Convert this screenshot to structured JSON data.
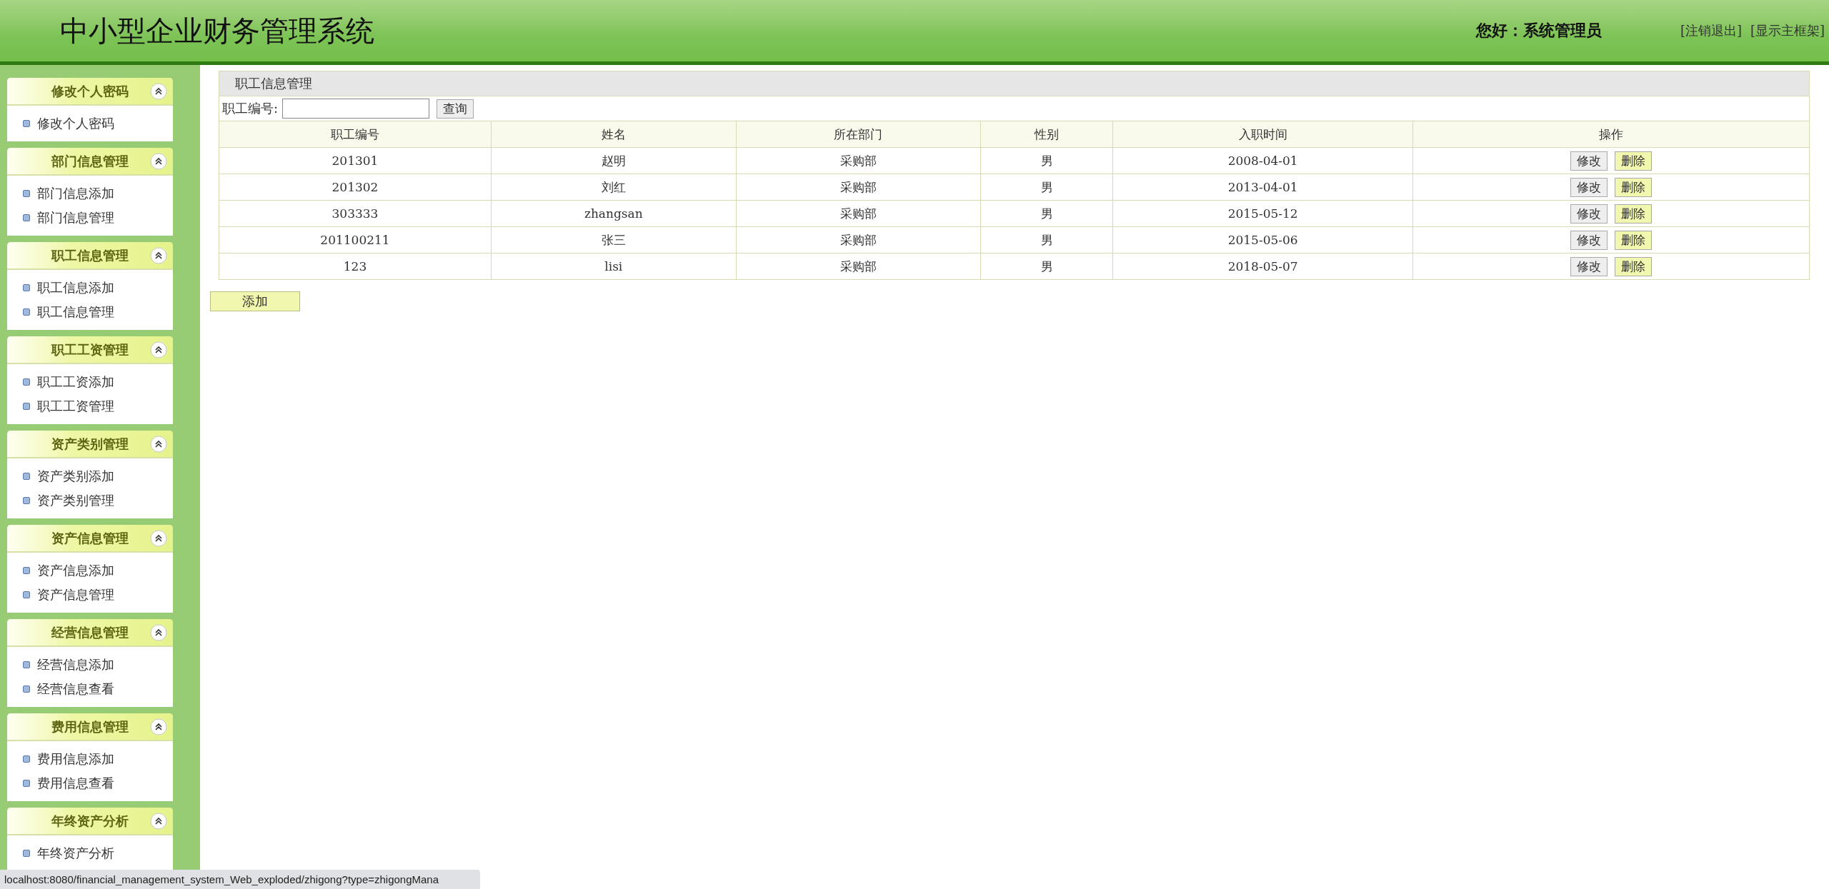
{
  "header": {
    "title": "中小型企业财务管理系统",
    "greeting": "您好：系统管理员",
    "links": [
      "[注销退出]",
      "[显示主框架]"
    ]
  },
  "sidebar": {
    "groups": [
      {
        "title": "修改个人密码",
        "expanded": true,
        "items": [
          "修改个人密码"
        ]
      },
      {
        "title": "部门信息管理",
        "expanded": true,
        "items": [
          "部门信息添加",
          "部门信息管理"
        ]
      },
      {
        "title": "职工信息管理",
        "expanded": true,
        "items": [
          "职工信息添加",
          "职工信息管理"
        ]
      },
      {
        "title": "职工工资管理",
        "expanded": true,
        "items": [
          "职工工资添加",
          "职工工资管理"
        ]
      },
      {
        "title": "资产类别管理",
        "expanded": true,
        "items": [
          "资产类别添加",
          "资产类别管理"
        ]
      },
      {
        "title": "资产信息管理",
        "expanded": true,
        "items": [
          "资产信息添加",
          "资产信息管理"
        ]
      },
      {
        "title": "经营信息管理",
        "expanded": true,
        "items": [
          "经营信息添加",
          "经营信息查看"
        ]
      },
      {
        "title": "费用信息管理",
        "expanded": true,
        "items": [
          "费用信息添加",
          "费用信息查看"
        ]
      },
      {
        "title": "年终资产分析",
        "expanded": true,
        "items": [
          "年终资产分析"
        ]
      }
    ]
  },
  "panel": {
    "title": "职工信息管理",
    "search_label": "职工编号:",
    "search_button": "查询",
    "table": {
      "columns": [
        "职工编号",
        "姓名",
        "所在部门",
        "性别",
        "入职时间",
        "操作"
      ],
      "rows": [
        {
          "cells": [
            "201301",
            "赵明",
            "采购部",
            "男",
            "2008-04-01"
          ],
          "actions": [
            "修改",
            "删除"
          ]
        },
        {
          "cells": [
            "201302",
            "刘红",
            "采购部",
            "男",
            "2013-04-01"
          ],
          "actions": [
            "修改",
            "删除"
          ]
        },
        {
          "cells": [
            "303333",
            "zhangsan",
            "采购部",
            "男",
            "2015-05-12"
          ],
          "actions": [
            "修改",
            "删除"
          ]
        },
        {
          "cells": [
            "201100211",
            "张三",
            "采购部",
            "男",
            "2015-05-06"
          ],
          "actions": [
            "修改",
            "删除"
          ]
        },
        {
          "cells": [
            "123",
            "lisi",
            "采购部",
            "男",
            "2018-05-07"
          ],
          "actions": [
            "修改",
            "删除"
          ]
        }
      ]
    },
    "add_button": "添加"
  },
  "status_bar": {
    "url": "localhost:8080/financial_management_system_Web_exploded/zhigong?type=zhigongMana"
  }
}
